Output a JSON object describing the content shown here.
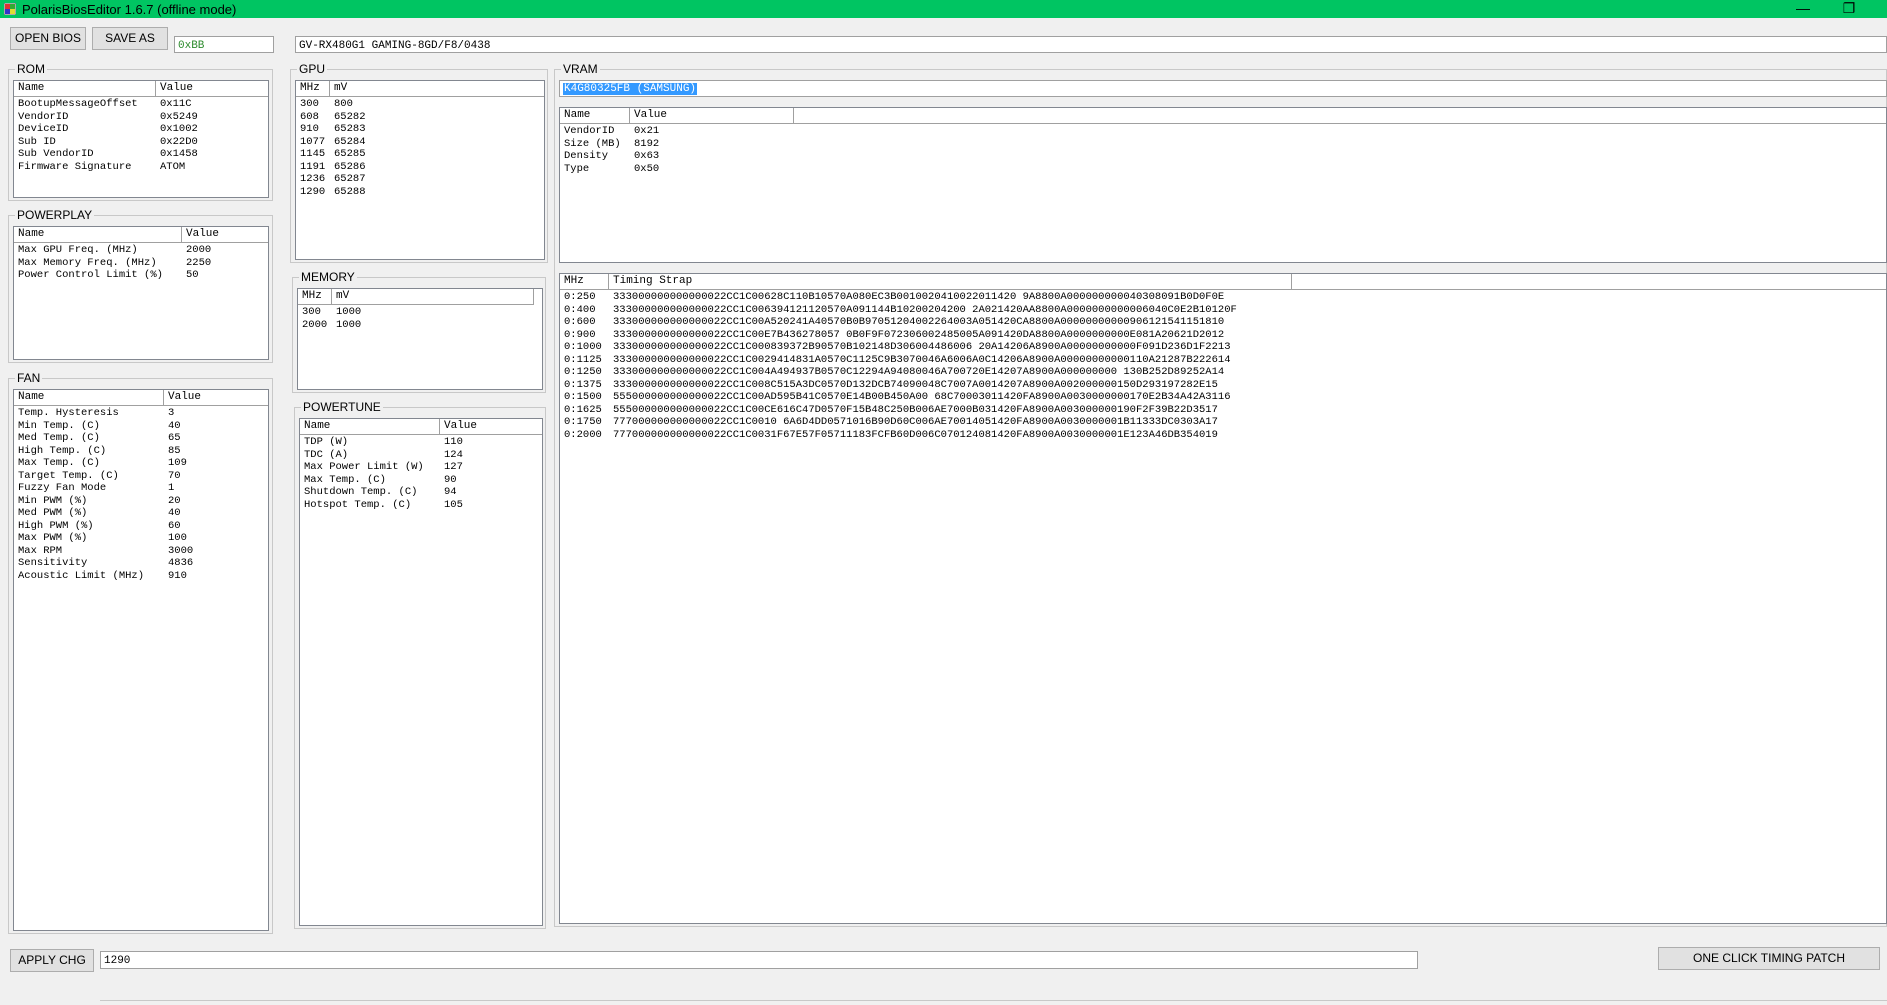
{
  "window": {
    "title": "PolarisBiosEditor 1.6.7 (offline mode)",
    "minimize_glyph": "—",
    "restore_glyph": "❐",
    "title_color": "#00c562"
  },
  "toolbar": {
    "open_bios_label": "OPEN BIOS",
    "save_as_label": "SAVE AS",
    "checksum_value": "0xBB",
    "bios_name_value": "GV-RX480G1 GAMING-8GD/F8/0438"
  },
  "rom": {
    "title": "ROM",
    "headers": [
      "Name",
      "Value"
    ],
    "rows": [
      [
        "BootupMessageOffset",
        "0x11C"
      ],
      [
        "VendorID",
        "0x5249"
      ],
      [
        "DeviceID",
        "0x1002"
      ],
      [
        "Sub ID",
        "0x22D0"
      ],
      [
        "Sub VendorID",
        "0x1458"
      ],
      [
        "Firmware Signature",
        "ATOM"
      ]
    ]
  },
  "powerplay": {
    "title": "POWERPLAY",
    "headers": [
      "Name",
      "Value"
    ],
    "rows": [
      [
        "Max GPU Freq. (MHz)",
        "2000"
      ],
      [
        "Max Memory Freq. (MHz)",
        "2250"
      ],
      [
        "Power Control Limit (%)",
        "50"
      ]
    ]
  },
  "fan": {
    "title": "FAN",
    "headers": [
      "Name",
      "Value"
    ],
    "rows": [
      [
        "Temp. Hysteresis",
        "3"
      ],
      [
        "Min Temp. (C)",
        "40"
      ],
      [
        "Med Temp. (C)",
        "65"
      ],
      [
        "High Temp. (C)",
        "85"
      ],
      [
        "Max Temp. (C)",
        "109"
      ],
      [
        "Target Temp. (C)",
        "70"
      ],
      [
        "Fuzzy Fan Mode",
        "1"
      ],
      [
        "Min PWM (%)",
        "20"
      ],
      [
        "Med PWM (%)",
        "40"
      ],
      [
        "High PWM (%)",
        "60"
      ],
      [
        "Max PWM (%)",
        "100"
      ],
      [
        "Max RPM",
        "3000"
      ],
      [
        "Sensitivity",
        "4836"
      ],
      [
        "Acoustic Limit (MHz)",
        "910"
      ]
    ]
  },
  "gpu": {
    "title": "GPU",
    "headers": [
      "MHz",
      "mV"
    ],
    "rows": [
      [
        "300",
        "800"
      ],
      [
        "608",
        "65282"
      ],
      [
        "910",
        "65283"
      ],
      [
        "1077",
        "65284"
      ],
      [
        "1145",
        "65285"
      ],
      [
        "1191",
        "65286"
      ],
      [
        "1236",
        "65287"
      ],
      [
        "1290",
        "65288"
      ]
    ]
  },
  "memory": {
    "title": "MEMORY",
    "headers": [
      "MHz",
      "mV"
    ],
    "rows": [
      [
        "300",
        "1000"
      ],
      [
        "2000",
        "1000"
      ]
    ]
  },
  "powertune": {
    "title": "POWERTUNE",
    "headers": [
      "Name",
      "Value"
    ],
    "rows": [
      [
        "TDP (W)",
        "110"
      ],
      [
        "TDC (A)",
        "124"
      ],
      [
        "Max Power Limit (W)",
        "127"
      ],
      [
        "Max Temp. (C)",
        "90"
      ],
      [
        "Shutdown Temp. (C)",
        "94"
      ],
      [
        "Hotspot Temp. (C)",
        "105"
      ]
    ]
  },
  "vram": {
    "title": "VRAM",
    "selected_module": "K4G80325FB (SAMSUNG)",
    "info_headers": [
      "Name",
      "Value"
    ],
    "info_rows": [
      [
        "VendorID",
        "0x21"
      ],
      [
        "Size (MB)",
        "8192"
      ],
      [
        "Density",
        "0x63"
      ],
      [
        "Type",
        "0x50"
      ]
    ],
    "timing_headers": [
      "MHz",
      "Timing Strap"
    ],
    "timing_rows": [
      [
        "0:250",
        "333000000000000022CC1C00628C110B10570A080EC3B0010020410022011420 9A8800A000000000040308091B0D0F0E"
      ],
      [
        "0:400",
        "333000000000000022CC1C006394121120570A091144B10200204200 2A021420AA8800A0000000000006040C0E2B10120F"
      ],
      [
        "0:600",
        "333000000000000022CC1C00A520241A40570B0B97051204002264003A051420CA8800A00000000000906121541151810"
      ],
      [
        "0:900",
        "333000000000000022CC1C00E7B436278057 0B0F9F072306002485005A091420DA8800A0000000000E081A20621D2012"
      ],
      [
        "0:1000",
        "333000000000000022CC1C000839372B90570B102148D306004486006 20A14206A8900A00000000000F091D236D1F2213"
      ],
      [
        "0:1125",
        "333000000000000022CC1C0029414831A0570C1125C9B3070046A6006A0C14206A8900A00000000000110A21287B222614"
      ],
      [
        "0:1250",
        "333000000000000022CC1C004A494937B0570C12294A94080046A700720E14207A8900A000000000 130B252D89252A14"
      ],
      [
        "0:1375",
        "333000000000000022CC1C008C515A3DC0570D132DCB74090048C7007A0014207A8900A002000000150D293197282E15"
      ],
      [
        "0:1500",
        "555000000000000022CC1C00AD595B41C0570E14B00B450A00 68C70003011420FA8900A0030000000170E2B34A42A3116"
      ],
      [
        "0:1625",
        "555000000000000022CC1C00CE616C47D0570F15B48C250B006AE7000B031420FA8900A003000000190F2F39B22D3517"
      ],
      [
        "0:1750",
        "777000000000000022CC1C0010 6A6D4DD0571016B90D60C006AE70014051420FA8900A0030000001B11333DC0303A17"
      ],
      [
        "0:2000",
        "777000000000000022CC1C0031F67E57F05711183FCFB60D006C070124081420FA8900A0030000001E123A46DB354019"
      ]
    ]
  },
  "bottom": {
    "apply_label": "APPLY CHG",
    "edit_value": "1290",
    "timing_patch_label": "ONE CLICK TIMING PATCH"
  }
}
